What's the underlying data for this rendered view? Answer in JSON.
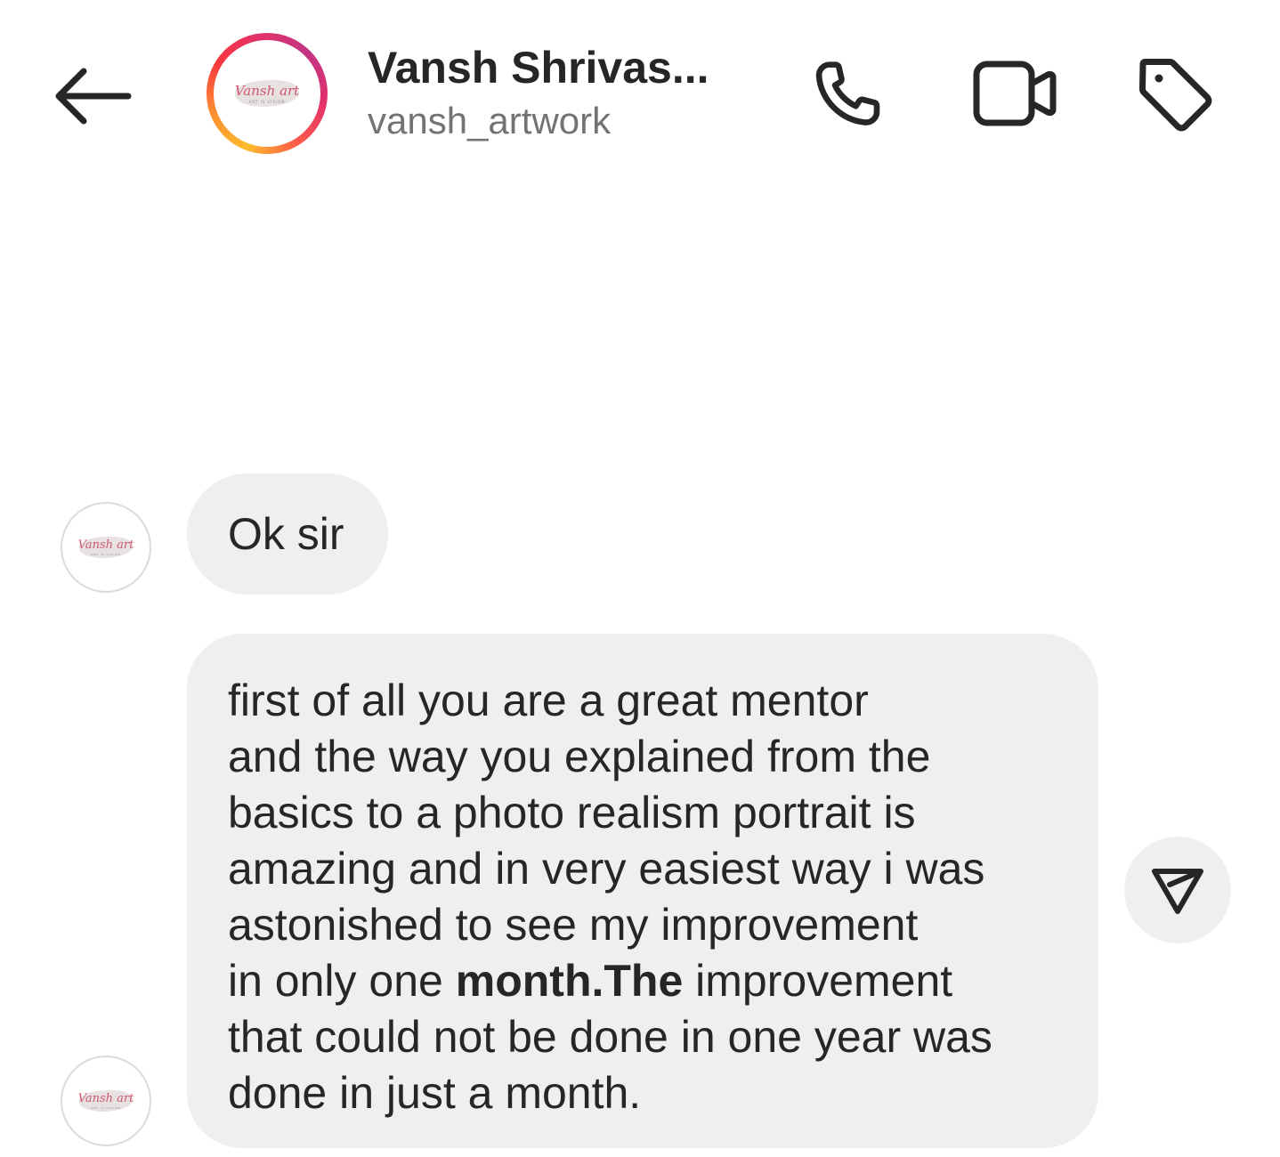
{
  "header": {
    "display_name": "Vansh Shrivas...",
    "username": "vansh_artwork",
    "logo_script": "Vansh art",
    "logo_tagline": "ART IS VISION",
    "ring_colors": [
      "#fdbb2d",
      "#f9373f",
      "#c13584"
    ]
  },
  "icons": {
    "back": "arrow-left",
    "call": "phone",
    "video": "video-camera",
    "tag": "tag",
    "share": "paper-plane"
  },
  "messages": [
    {
      "text": "Ok sir"
    },
    {
      "lines": [
        "first of all you are a great mentor",
        "and the way you explained from the",
        "basics to a photo realism portrait is",
        "amazing and in very easiest way i was",
        "astonished to see my improvement"
      ],
      "line6_before": "in only one ",
      "line6_bold": "month.The",
      "line6_after": " improvement",
      "lines_end": [
        "that could not be done in one year was",
        "done in just a month."
      ]
    }
  ],
  "colors": {
    "bubble": "#efefef",
    "text": "#262626",
    "secondary_text": "#737373"
  }
}
